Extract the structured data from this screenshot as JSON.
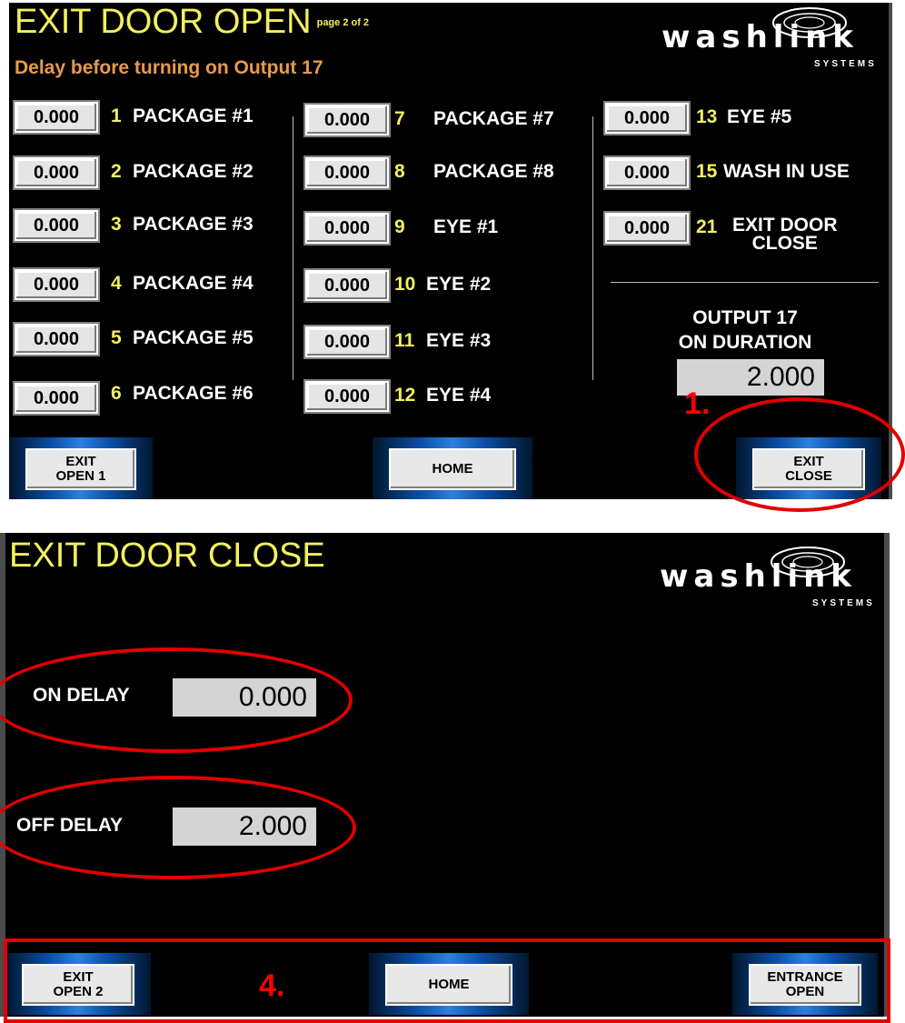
{
  "screen1": {
    "title": "EXIT DOOR OPEN",
    "page_indicator": "page 2 of 2",
    "subtitle": "Delay before turning on Output 17",
    "logo_text": "washlink",
    "logo_sub": "SYSTEMS",
    "col1": [
      {
        "value": "0.000",
        "num": "1",
        "label": "PACKAGE #1"
      },
      {
        "value": "0.000",
        "num": "2",
        "label": "PACKAGE #2"
      },
      {
        "value": "0.000",
        "num": "3",
        "label": "PACKAGE #3"
      },
      {
        "value": "0.000",
        "num": "4",
        "label": "PACKAGE #4"
      },
      {
        "value": "0.000",
        "num": "5",
        "label": "PACKAGE #5"
      },
      {
        "value": "0.000",
        "num": "6",
        "label": "PACKAGE #6"
      }
    ],
    "col2": [
      {
        "value": "0.000",
        "num": "7",
        "label": "PACKAGE #7"
      },
      {
        "value": "0.000",
        "num": "8",
        "label": "PACKAGE #8"
      },
      {
        "value": "0.000",
        "num": "9",
        "label": "EYE #1"
      },
      {
        "value": "0.000",
        "num": "10",
        "label": "EYE #2"
      },
      {
        "value": "0.000",
        "num": "11",
        "label": "EYE #3"
      },
      {
        "value": "0.000",
        "num": "12",
        "label": "EYE #4"
      }
    ],
    "col3": [
      {
        "value": "0.000",
        "num": "13",
        "label": "EYE #5"
      },
      {
        "value": "0.000",
        "num": "15",
        "label": "WASH IN USE"
      },
      {
        "value": "0.000",
        "num": "21",
        "label": "EXIT DOOR\nCLOSE"
      }
    ],
    "output_label_1": "OUTPUT 17",
    "output_label_2": "ON DURATION",
    "output_value": "2.000",
    "buttons": {
      "left": "EXIT\nOPEN 1",
      "home": "HOME",
      "right": "EXIT\nCLOSE"
    },
    "annotation": "1."
  },
  "screen2": {
    "title": "EXIT DOOR CLOSE",
    "logo_text": "washlink",
    "logo_sub": "SYSTEMS",
    "on_delay_label": "ON DELAY",
    "on_delay_value": "0.000",
    "off_delay_label": "OFF DELAY",
    "off_delay_value": "2.000",
    "buttons": {
      "left": "EXIT\nOPEN 2",
      "home": "HOME",
      "right": "ENTRANCE\nOPEN"
    },
    "annotation": "4."
  },
  "colors": {
    "title": "#f2f060",
    "subtitle": "#e89a4c",
    "annotation": "#e00000",
    "background": "#000000"
  }
}
